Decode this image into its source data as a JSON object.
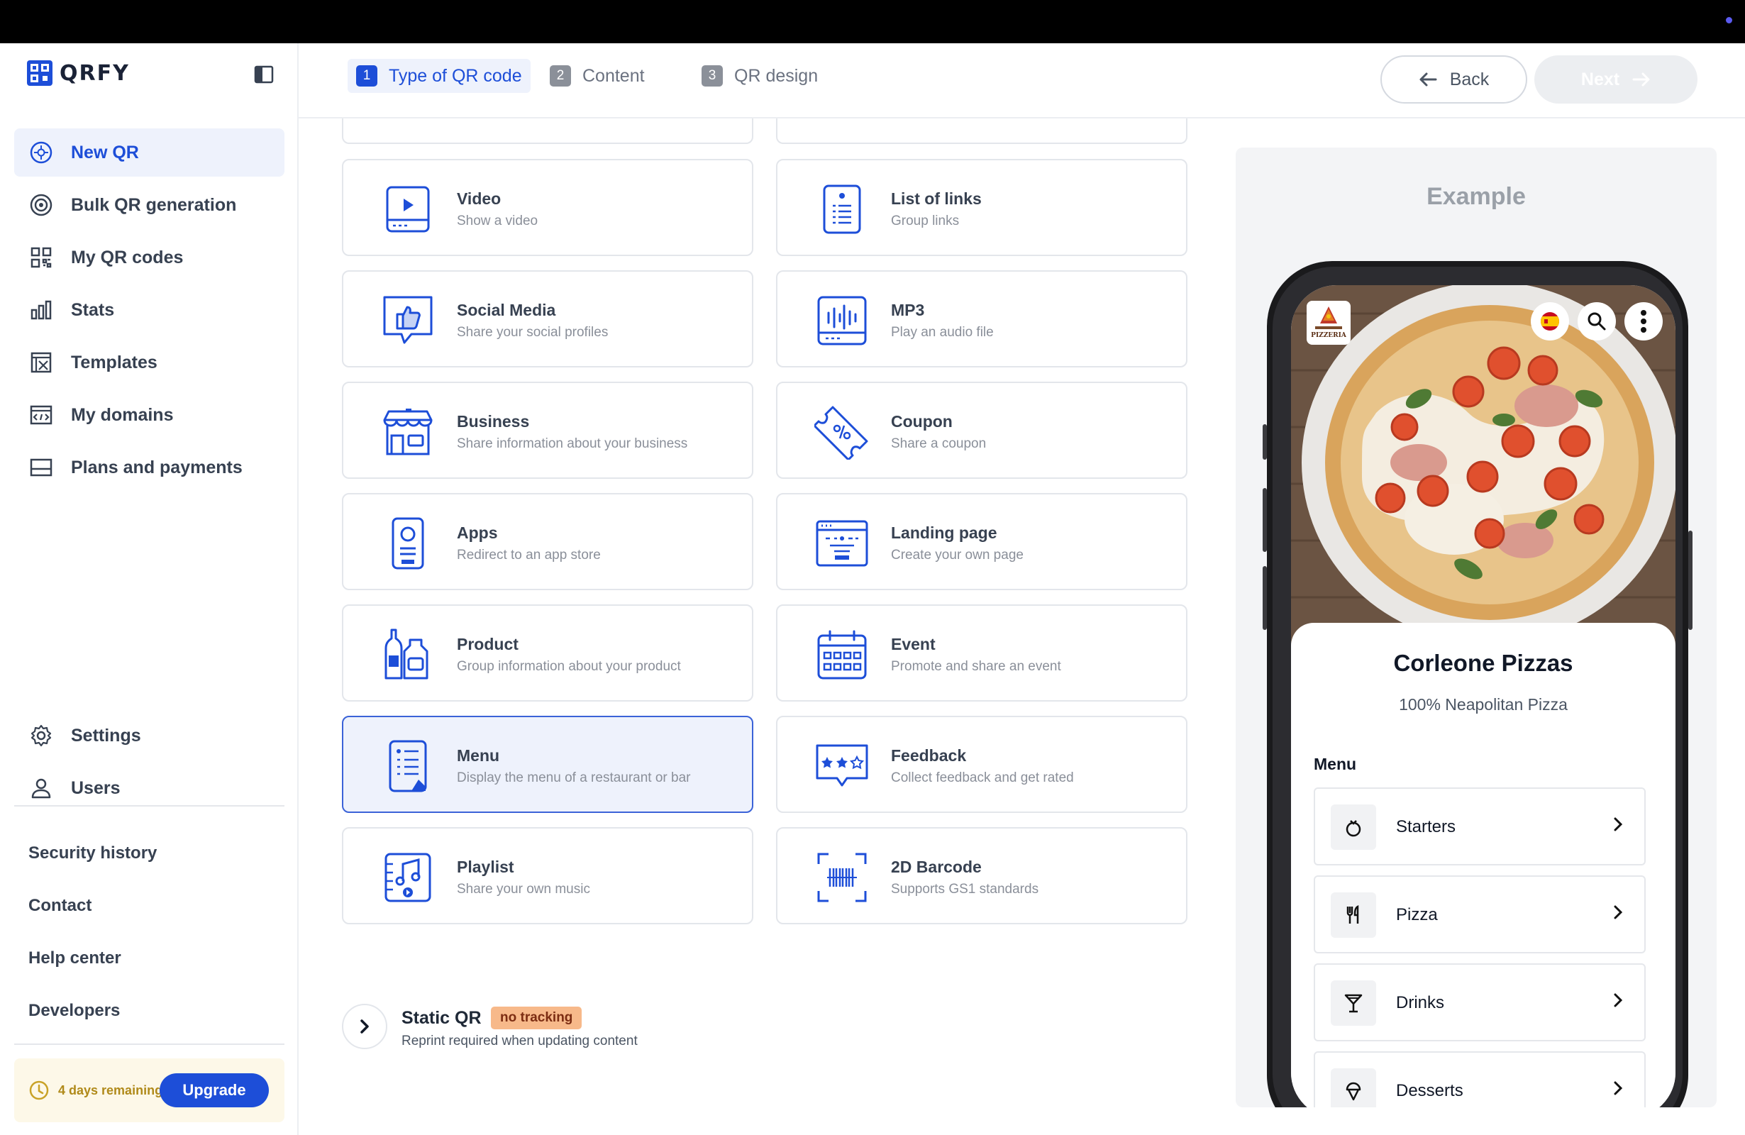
{
  "app": {
    "name": "QRFY"
  },
  "sidebar": {
    "nav": [
      {
        "label": "New QR",
        "icon": "plus-circle-icon",
        "active": true
      },
      {
        "label": "Bulk QR generation",
        "icon": "target-icon"
      },
      {
        "label": "My QR codes",
        "icon": "qr-grid-icon"
      },
      {
        "label": "Stats",
        "icon": "bar-chart-icon"
      },
      {
        "label": "Templates",
        "icon": "template-icon"
      },
      {
        "label": "My domains",
        "icon": "domain-icon"
      },
      {
        "label": "Plans and payments",
        "icon": "card-icon"
      }
    ],
    "bottom_nav": [
      {
        "label": "Settings",
        "icon": "gear-icon"
      },
      {
        "label": "Users",
        "icon": "user-icon"
      }
    ],
    "links": [
      "Security history",
      "Contact",
      "Help center",
      "Developers"
    ],
    "trial": {
      "text": "4 days remaining",
      "upgrade_label": "Upgrade"
    }
  },
  "header": {
    "steps": [
      {
        "num": "1",
        "label": "Type of QR code",
        "active": true
      },
      {
        "num": "2",
        "label": "Content"
      },
      {
        "num": "3",
        "label": "QR design"
      }
    ],
    "back_label": "Back",
    "next_label": "Next"
  },
  "qr_types": [
    {
      "title": "Video",
      "sub": "Show a video",
      "icon": "video-icon"
    },
    {
      "title": "List of links",
      "sub": "Group links",
      "icon": "list-links-icon"
    },
    {
      "title": "Social Media",
      "sub": "Share your social profiles",
      "icon": "thumbs-up-icon"
    },
    {
      "title": "MP3",
      "sub": "Play an audio file",
      "icon": "audio-icon"
    },
    {
      "title": "Business",
      "sub": "Share information about your business",
      "icon": "store-icon"
    },
    {
      "title": "Coupon",
      "sub": "Share a coupon",
      "icon": "coupon-icon"
    },
    {
      "title": "Apps",
      "sub": "Redirect to an app store",
      "icon": "phone-app-icon"
    },
    {
      "title": "Landing page",
      "sub": "Create your own page",
      "icon": "landing-page-icon"
    },
    {
      "title": "Product",
      "sub": "Group information about your product",
      "icon": "product-icon"
    },
    {
      "title": "Event",
      "sub": "Promote and share an event",
      "icon": "calendar-icon"
    },
    {
      "title": "Menu",
      "sub": "Display the menu of a restaurant or bar",
      "icon": "menu-icon",
      "selected": true
    },
    {
      "title": "Feedback",
      "sub": "Collect feedback and get rated",
      "icon": "feedback-stars-icon"
    },
    {
      "title": "Playlist",
      "sub": "Share your own music",
      "icon": "playlist-icon"
    },
    {
      "title": "2D Barcode",
      "sub": "Supports GS1 standards",
      "icon": "barcode-icon"
    }
  ],
  "static_qr": {
    "title": "Static QR",
    "badge": "no tracking",
    "sub": "Reprint required when updating content"
  },
  "example": {
    "title": "Example",
    "logo_text": "PIZZERIA",
    "business_name": "Corleone Pizzas",
    "tagline": "100% Neapolitan Pizza",
    "menu_label": "Menu",
    "menu_items": [
      {
        "label": "Starters",
        "icon": "starter-icon"
      },
      {
        "label": "Pizza",
        "icon": "cutlery-icon"
      },
      {
        "label": "Drinks",
        "icon": "cocktail-icon"
      },
      {
        "label": "Desserts",
        "icon": "ice-cream-icon"
      }
    ]
  },
  "colors": {
    "accent": "#1d4ed8",
    "selected_bg": "#eef2fc",
    "trial_text": "#b08a1a",
    "badge_bg": "#f7b98a"
  }
}
